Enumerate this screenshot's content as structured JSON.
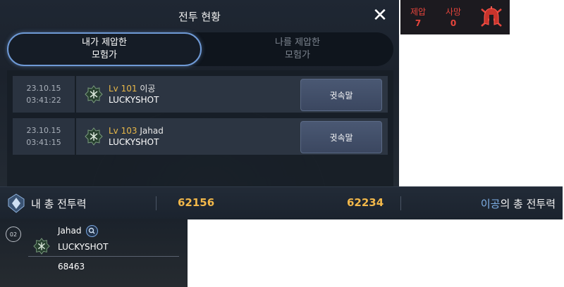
{
  "panel": {
    "title": "전투 현황",
    "tabs": [
      {
        "line1": "내가 제압한",
        "line2": "모험가",
        "active": true
      },
      {
        "line1": "나를 제압한",
        "line2": "모험가",
        "active": false
      }
    ],
    "rows": [
      {
        "date": "23.10.15",
        "time": "03:41:22",
        "level": "Lv 101",
        "name": "이공",
        "guild": "LUCKYSHOT",
        "button": "귓속말"
      },
      {
        "date": "23.10.15",
        "time": "03:41:15",
        "level": "Lv 103",
        "name": "Jahad",
        "guild": "LUCKYSHOT",
        "button": "귓속말"
      }
    ]
  },
  "stats": {
    "suppress_label": "제압",
    "suppress_value": "7",
    "death_label": "사망",
    "death_value": "0",
    "accent": "#e6453c"
  },
  "power": {
    "my_label": "내 총 전투력",
    "my_value": "62156",
    "enemy_value": "62234",
    "enemy_name": "이공",
    "enemy_suffix": "의 총 전투력",
    "value_color": "#f2b84a"
  },
  "card": {
    "rank": "02",
    "name": "Jahad",
    "guild": "LUCKYSHOT",
    "power": "68463"
  }
}
